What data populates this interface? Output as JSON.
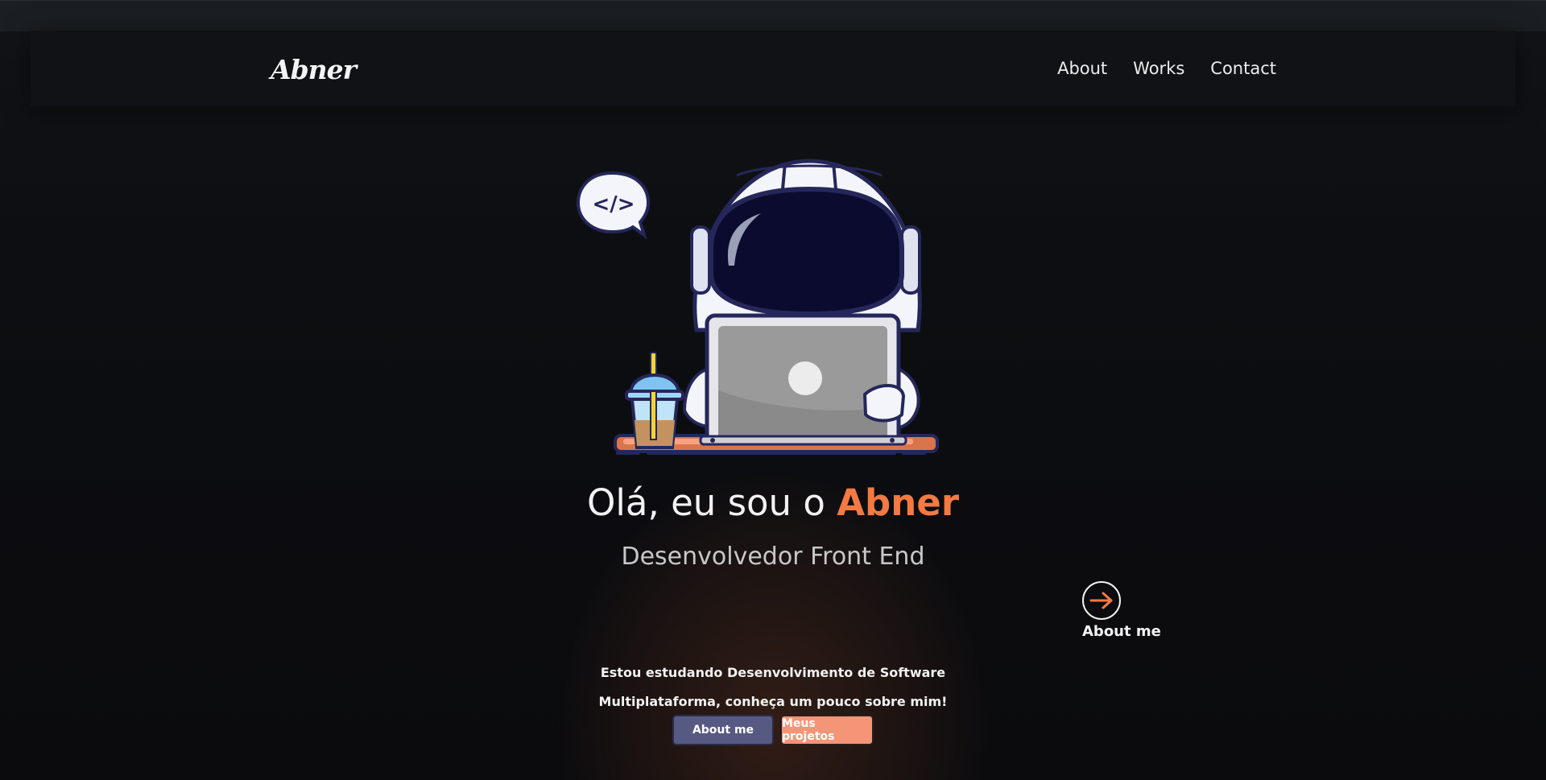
{
  "header": {
    "logo": "Abner",
    "nav": [
      {
        "label": "About"
      },
      {
        "label": "Works"
      },
      {
        "label": "Contact"
      }
    ]
  },
  "hero": {
    "illustration": {
      "icon": "astronaut-coding-illustration",
      "speech_bubble_text": "</>"
    },
    "title_prefix": "Olá, eu sou o ",
    "title_name": "Abner",
    "subtitle": "Desenvolvedor Front End",
    "about_link": {
      "icon": "arrow-right-icon",
      "label": "About me"
    },
    "intro_lines": [
      "Estou estudando Desenvolvimento de Software",
      "Multiplataforma, conheça um pouco sobre mim!"
    ],
    "buttons": {
      "primary": "About me",
      "secondary": "Meus projetos"
    }
  },
  "colors": {
    "accent": "#f47a42",
    "background": "#0c0d10",
    "primary_button": "#565a83",
    "secondary_button": "#f59577"
  }
}
